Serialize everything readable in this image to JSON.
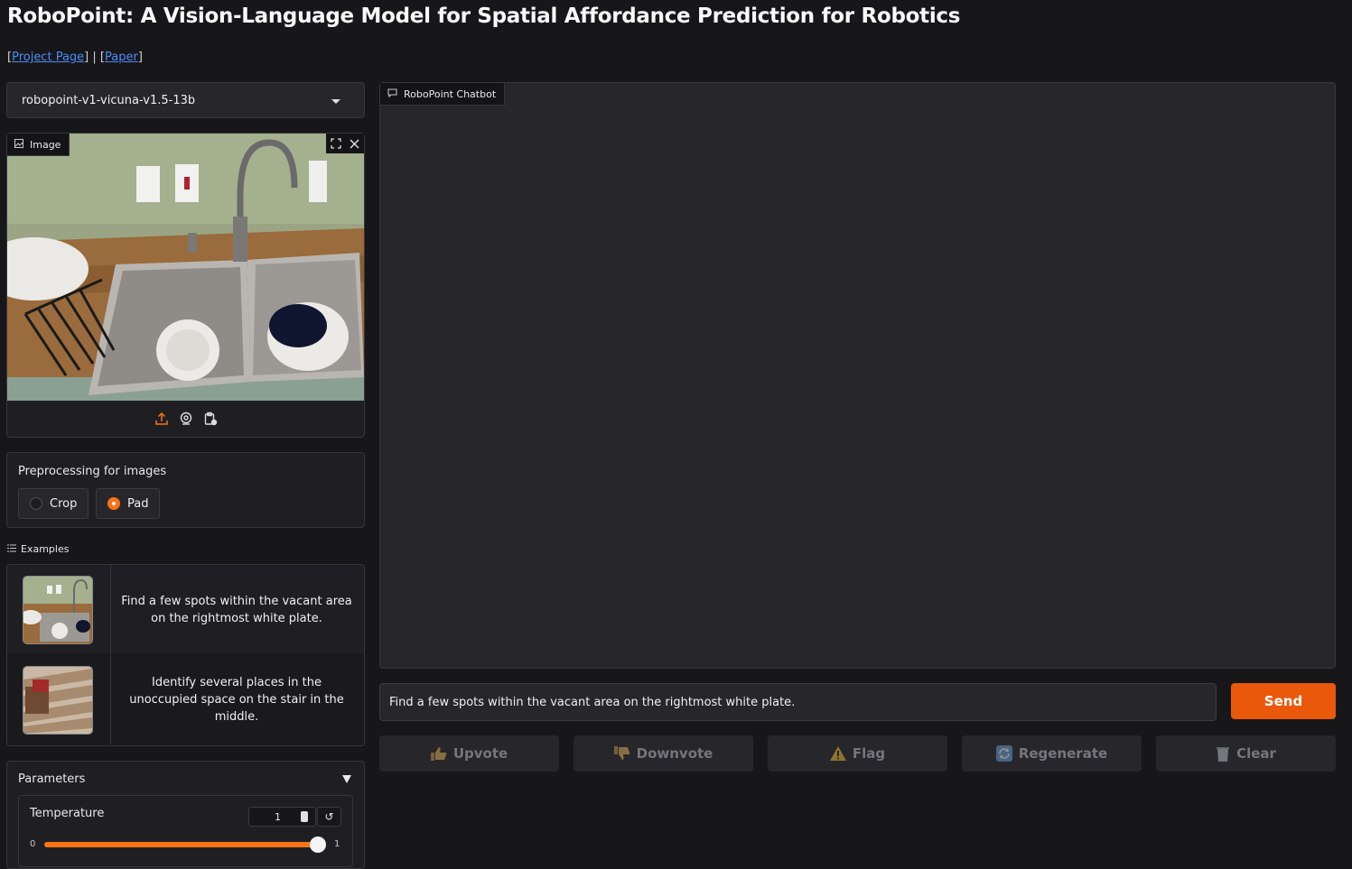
{
  "header": {
    "title": "RoboPoint: A Vision-Language Model for Spatial Affordance Prediction for Robotics",
    "links": [
      {
        "label": "Project Page"
      },
      {
        "label": "Paper"
      }
    ],
    "link_separator": " | "
  },
  "model_select": {
    "value": "robopoint-v1-vicuna-v1.5-13b"
  },
  "image_panel": {
    "label": "Image"
  },
  "preprocessing": {
    "label": "Preprocessing for images",
    "options": [
      {
        "label": "Crop",
        "selected": false
      },
      {
        "label": "Pad",
        "selected": true
      }
    ]
  },
  "examples": {
    "label": "Examples",
    "items": [
      {
        "text": "Find a few spots within the vacant area on the rightmost white plate.",
        "thumbnail": "kitchen-sink"
      },
      {
        "text": "Identify several places in the unoccupied space on the stair in the middle.",
        "thumbnail": "stairs"
      }
    ]
  },
  "parameters": {
    "label": "Parameters",
    "temperature": {
      "label": "Temperature",
      "value": "1",
      "min": "0",
      "max": "1",
      "fraction": 1.0
    }
  },
  "chatbot": {
    "label": "RoboPoint Chatbot"
  },
  "input": {
    "value": "Find a few spots within the vacant area on the rightmost white plate."
  },
  "send_label": "Send",
  "actions": [
    {
      "label": "Upvote",
      "icon": "thumbs-up-icon"
    },
    {
      "label": "Downvote",
      "icon": "thumbs-down-icon"
    },
    {
      "label": "Flag",
      "icon": "warning-icon"
    },
    {
      "label": "Regenerate",
      "icon": "refresh-icon"
    },
    {
      "label": "Clear",
      "icon": "trash-icon"
    }
  ],
  "colors": {
    "accent": "#ea580c",
    "background": "#17171a",
    "panel": "#1f1f23"
  }
}
